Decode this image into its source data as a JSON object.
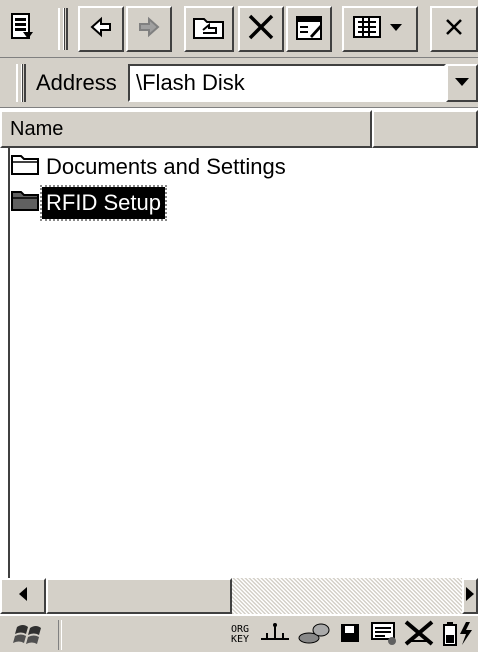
{
  "address": {
    "label": "Address",
    "value": "\\Flash Disk"
  },
  "columns": [
    {
      "label": "Name"
    },
    {
      "label": ""
    }
  ],
  "files": [
    {
      "name": "Documents and Settings",
      "selected": false
    },
    {
      "name": "RFID Setup",
      "selected": true
    }
  ],
  "tray": {
    "input_indicator_top": "ORG",
    "input_indicator_bottom": "KEY"
  },
  "icons": [
    "view-icon",
    "back-icon",
    "forward-icon",
    "up-folder-icon",
    "delete-icon",
    "properties-icon",
    "views-menu-icon",
    "close-icon",
    "folder-icon",
    "start-icon",
    "usb-icon",
    "network-icon",
    "storage-icon",
    "keyboard-icon",
    "wifi-off-icon",
    "battery-icon"
  ]
}
